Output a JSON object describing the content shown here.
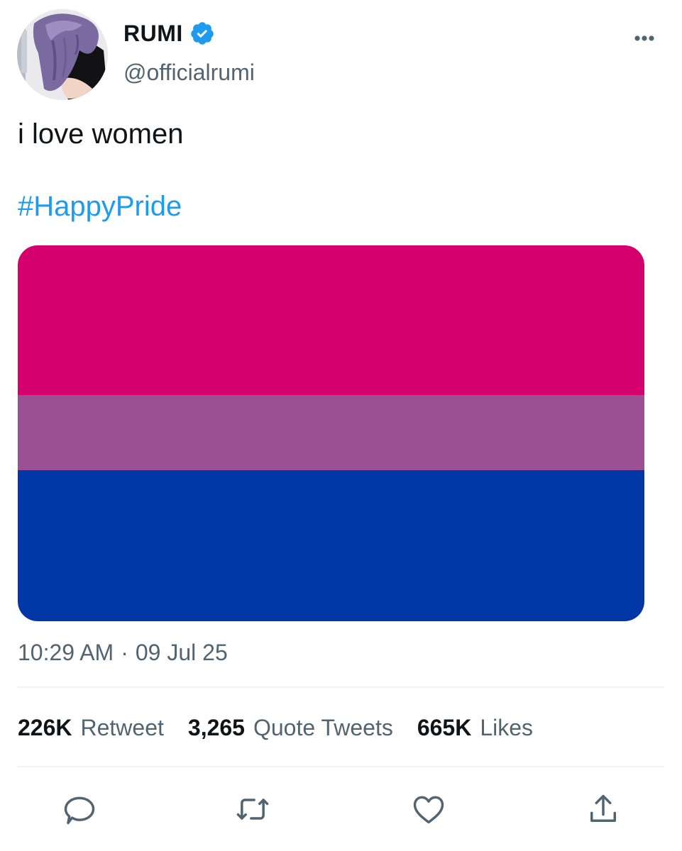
{
  "author": {
    "display_name": "RUMI",
    "handle": "@officialrumi",
    "verified": true
  },
  "tweet": {
    "text": "i love women",
    "hashtag": "#HappyPride",
    "time": "10:29 AM",
    "separator": "·",
    "date": "09 Jul 25"
  },
  "media": {
    "stripes": [
      "#d3006e",
      "#9b5094",
      "#0237a8"
    ]
  },
  "stats": {
    "retweets": {
      "count": "226K",
      "label": "Retweet"
    },
    "quotes": {
      "count": "3,265",
      "label": "Quote Tweets"
    },
    "likes": {
      "count": "665K",
      "label": "Likes"
    }
  },
  "colors": {
    "accent": "#1d9bf0",
    "secondary_text": "#536471",
    "primary_text": "#0f1419"
  },
  "icons": {
    "more": "more-horizontal-icon",
    "reply": "speech-bubble-icon",
    "retweet": "retweet-arrows-icon",
    "like": "heart-icon",
    "share": "share-upload-icon"
  }
}
